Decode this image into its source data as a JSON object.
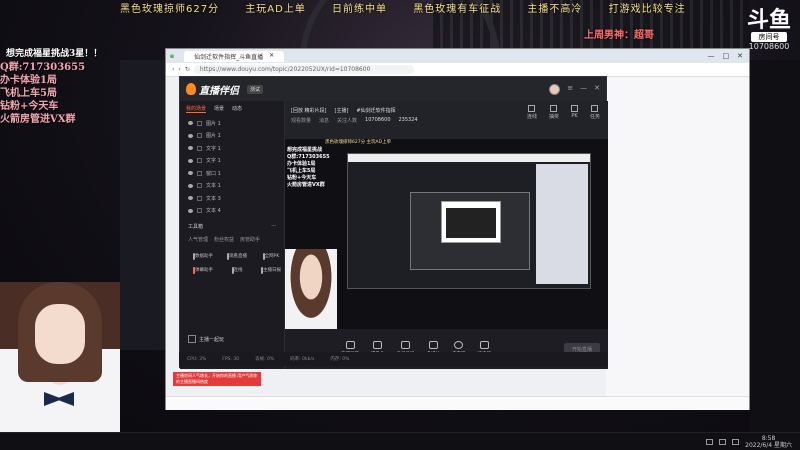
{
  "overlay": {
    "ticker": [
      "黑色玫瑰掠师627分",
      "主玩AD上单",
      "日前练中单",
      "黑色玫瑰有车征战",
      "主播不高冷",
      "打游戏比较专注"
    ],
    "room_logo": "斗鱼",
    "room_label": "房间号",
    "room_number": "10708600",
    "guard_text": "上周男神：超哥",
    "side_notes": [
      "想完成福星挑战3星！！",
      "Q群:717303655",
      "办卡体验1局",
      "飞机上车5局",
      "钻粉+今天车",
      "火箭房管进VX群"
    ]
  },
  "browser": {
    "tab_title": "仙剑迁软件指挥_斗鱼直播",
    "url": "https://www.douyu.com/topic/2022052UX/rid=10708600",
    "window_controls": [
      "—",
      "□",
      "✕"
    ]
  },
  "client": {
    "logo": "直播伴侣",
    "badge": "测试",
    "left_tabs": [
      "我的场景",
      "场景",
      "动态"
    ],
    "scenes": [
      "图片 1",
      "图片 1",
      "文字 1",
      "文字 1",
      "窗口 1",
      "文本 1",
      "文本 3",
      "文本 4"
    ],
    "tools_title": "工具箱",
    "tools_tabs": [
      "人气管理",
      "粉丝权益",
      "房管助手"
    ],
    "tools": [
      {
        "label": "数据助手",
        "hot": false
      },
      {
        "label": "观看直播",
        "hot": false
      },
      {
        "label": "全网PK",
        "hot": false
      },
      {
        "label": "弹幕助手",
        "hot": true
      },
      {
        "label": "连线",
        "hot": false
      },
      {
        "label": "主播日报",
        "hot": false
      }
    ],
    "add_label": "主播一起玩",
    "top_info": [
      "[回放 精彩片段]",
      "[主播]",
      "#仙剑迁软件指挥"
    ],
    "top_sub": [
      "观看数量",
      "消息",
      "关注人数",
      "10708600",
      "235324"
    ],
    "top_actions": [
      "连线",
      "抽奖",
      "PK",
      "任务"
    ],
    "preview_overlay": [
      "想完成福星挑战",
      "Q群:717303655",
      "办卡体验1局",
      "飞机上车5局",
      "钻粉+今天车",
      "火箭房管进VX群"
    ],
    "controls": [
      "直播屏幕",
      "摄像头",
      "手机投屏",
      "多媒体",
      "麦克风",
      "扬声器"
    ],
    "start_label": "开始直播",
    "status": [
      "CPU: 3%",
      "FPS: 30",
      "丢帧: 0%",
      "码率: 0kb/s",
      "内存: 0%"
    ]
  },
  "tip_red": "主播房间人气增长，开始你的直播 用户气质你的主播直播间热度",
  "taskbar": {
    "time": "8:58",
    "date": "2022/6/4 星期六"
  },
  "colors": {
    "accent": "#ff6a3d",
    "ticker": "#f5e08a",
    "side_notes": "#f4a6b0",
    "guard": "#ff6b6b"
  }
}
